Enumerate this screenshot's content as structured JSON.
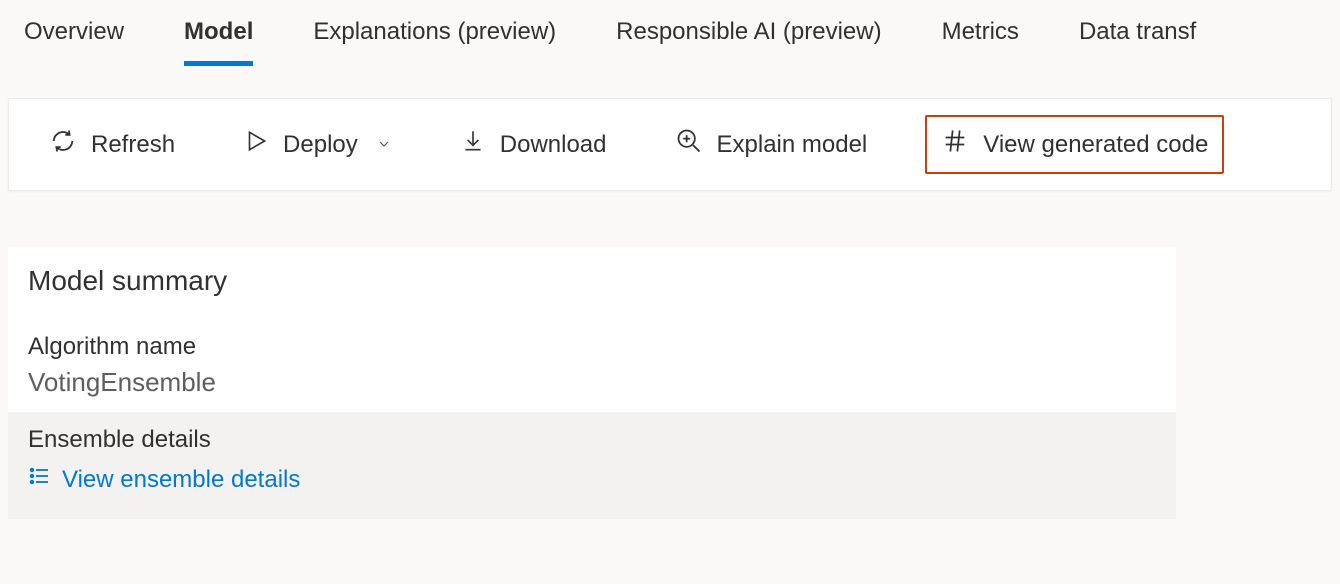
{
  "tabs": {
    "overview": "Overview",
    "model": "Model",
    "explanations": "Explanations (preview)",
    "responsible_ai": "Responsible AI (preview)",
    "metrics": "Metrics",
    "data_transf": "Data transf"
  },
  "toolbar": {
    "refresh": "Refresh",
    "deploy": "Deploy",
    "download": "Download",
    "explain_model": "Explain model",
    "view_generated_code": "View generated code"
  },
  "summary": {
    "title": "Model summary",
    "algorithm_label": "Algorithm name",
    "algorithm_value": "VotingEnsemble",
    "ensemble_label": "Ensemble details",
    "ensemble_link": "View ensemble details"
  },
  "highlighted_button": "view_generated_code"
}
